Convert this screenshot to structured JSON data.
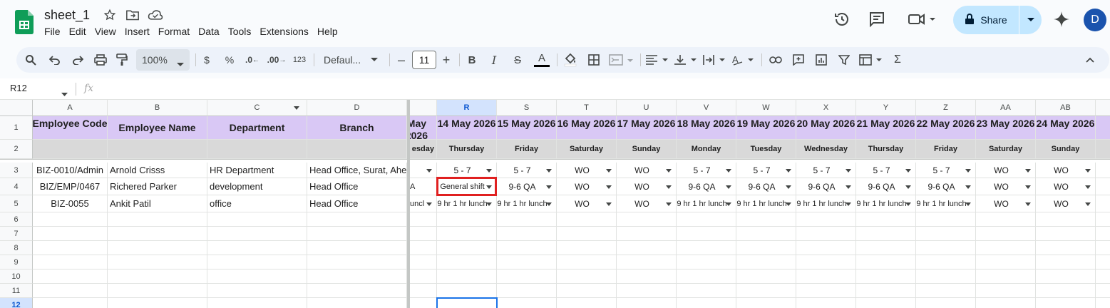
{
  "app": {
    "doc_title": "sheet_1",
    "menu": [
      "File",
      "Edit",
      "View",
      "Insert",
      "Format",
      "Data",
      "Tools",
      "Extensions",
      "Help"
    ],
    "share_label": "Share",
    "avatar_initial": "D"
  },
  "toolbar": {
    "zoom": "100%",
    "currency": "$",
    "percent": "%",
    "dec_decrease": ".0",
    "dec_increase": ".00",
    "number_format": "123",
    "font": "Defaul...",
    "font_size": "11",
    "sigma": "Σ"
  },
  "formula_bar": {
    "cell_ref": "R12",
    "fx": "fx"
  },
  "grid": {
    "frozen_columns": [
      "A",
      "B",
      "C",
      "D"
    ],
    "scroll_columns": [
      "R",
      "S",
      "T",
      "U",
      "V",
      "W",
      "X",
      "Y",
      "Z",
      "AA",
      "AB"
    ],
    "selected_column": "R",
    "rows": [
      "1",
      "2",
      "3",
      "4",
      "5",
      "6",
      "7",
      "8",
      "9",
      "10",
      "11",
      "12"
    ],
    "selected_row": "12",
    "header_row1": [
      "Employee Code",
      "Employee Name",
      "Department",
      "Branch"
    ],
    "partial_date": "May 2026",
    "partial_day": "esday",
    "dates": [
      "14 May 2026",
      "15 May 2026",
      "16 May 2026",
      "17 May 2026",
      "18 May 2026",
      "19 May 2026",
      "20 May 2026",
      "21 May 2026",
      "22 May 2026",
      "23 May 2026",
      "24 May 2026"
    ],
    "days": [
      "Thursday",
      "Friday",
      "Saturday",
      "Sunday",
      "Monday",
      "Tuesday",
      "Wednesday",
      "Thursday",
      "Friday",
      "Saturday",
      "Sunday"
    ],
    "employees": [
      {
        "code": "BIZ-0010/Admin",
        "name": "Arnold Crisss",
        "department": "HR Department",
        "branch": "Head Office, Surat, Ahe",
        "partial": "",
        "shifts": [
          "5 - 7",
          "5 - 7",
          "WO",
          "WO",
          "5 - 7",
          "5 - 7",
          "5 - 7",
          "5 - 7",
          "5 - 7",
          "WO",
          "WO"
        ]
      },
      {
        "code": "BIZ/EMP/0467",
        "name": "Richered Parker",
        "department": "development",
        "branch": "Head Office",
        "partial": "A",
        "shifts": [
          "General shift",
          "9-6 QA",
          "WO",
          "WO",
          "9-6 QA",
          "9-6 QA",
          "9-6 QA",
          "9-6 QA",
          "9-6 QA",
          "WO",
          "WO"
        ]
      },
      {
        "code": "BIZ-0055",
        "name": "Ankit Patil",
        "department": "office",
        "branch": "Head Office",
        "partial": "uncl",
        "shifts": [
          "9 hr 1 hr lunch",
          "9 hr 1 hr lunch",
          "WO",
          "WO",
          "9 hr 1 hr lunch",
          "9 hr 1 hr lunch",
          "9 hr 1 hr lunch",
          "9 hr 1 hr lunch",
          "9 hr 1 hr lunch",
          "WO",
          "WO"
        ]
      }
    ]
  }
}
